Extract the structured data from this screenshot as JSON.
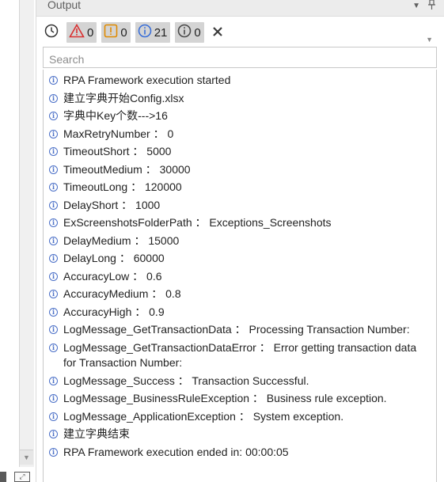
{
  "panel": {
    "title": "Output"
  },
  "toolbar": {
    "errors_count": "0",
    "warnings_count": "0",
    "info_count": "21",
    "trace_count": "0"
  },
  "search": {
    "placeholder": "Search"
  },
  "log": [
    "RPA Framework execution started",
    "建立字典开始Config.xlsx",
    "字典中Key个数--->16",
    "MaxRetryNumber ： 0",
    "TimeoutShort ： 5000",
    "TimeoutMedium ： 30000",
    "TimeoutLong ： 120000",
    "DelayShort ： 1000",
    "ExScreenshotsFolderPath ： Exceptions_Screenshots",
    "DelayMedium ： 15000",
    "DelayLong ： 60000",
    "AccuracyLow ： 0.6",
    "AccuracyMedium ： 0.8",
    "AccuracyHigh ： 0.9",
    "LogMessage_GetTransactionData ： Processing Transaction Number:",
    "LogMessage_GetTransactionDataError ： Error getting transaction data for Transaction Number:",
    "LogMessage_Success ： Transaction Successful.",
    "LogMessage_BusinessRuleException ： Business rule exception.",
    "LogMessage_ApplicationException ： System exception.",
    "建立字典结束",
    "RPA Framework execution ended in: 00:00:05"
  ]
}
